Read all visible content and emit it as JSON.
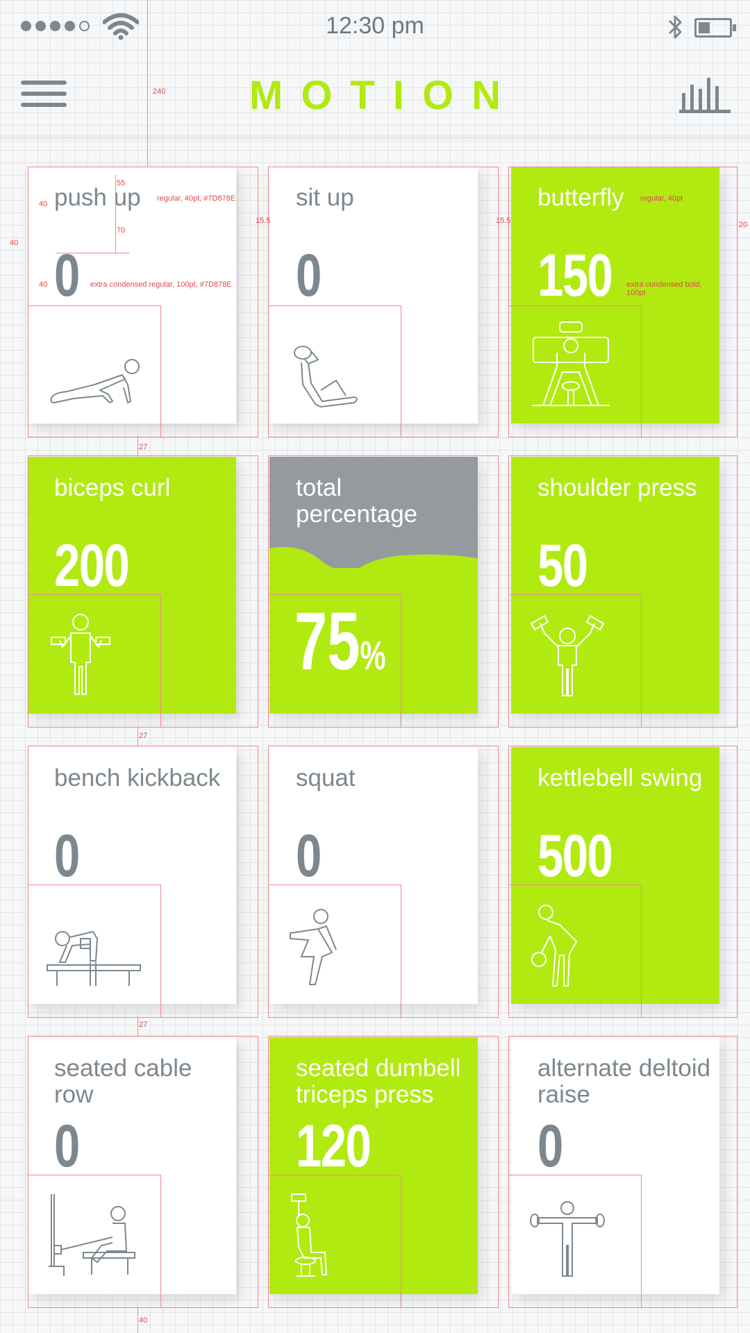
{
  "status_bar": {
    "time": "12:30 pm",
    "signal_dots": 5,
    "signal_filled": 4,
    "icons": [
      "wifi-icon",
      "bluetooth-icon",
      "battery-icon"
    ]
  },
  "header": {
    "title": "MOTION",
    "menu_icon": "hamburger-menu-icon",
    "stats_icon": "bar-chart-icon"
  },
  "colors": {
    "accent": "#B1EA10",
    "text": "#7D878E",
    "card": "#FFFFFF",
    "guide": "#F08A8A"
  },
  "exercises": [
    {
      "name": "push up",
      "value": "0",
      "style": "white",
      "icon": "push-up-figure"
    },
    {
      "name": "sit up",
      "value": "0",
      "style": "white",
      "icon": "sit-up-figure"
    },
    {
      "name": "butterfly",
      "value": "150",
      "style": "green",
      "icon": "butterfly-machine-figure"
    },
    {
      "name": "biceps curl",
      "value": "200",
      "style": "green",
      "icon": "biceps-curl-figure"
    },
    {
      "name": "total percentage",
      "value": "75",
      "unit": "%",
      "style": "percent",
      "icon": "wave"
    },
    {
      "name": "shoulder press",
      "value": "50",
      "style": "green",
      "icon": "shoulder-press-figure"
    },
    {
      "name": "bench kickback",
      "value": "0",
      "style": "white",
      "icon": "bench-kickback-figure"
    },
    {
      "name": "squat",
      "value": "0",
      "style": "white",
      "icon": "squat-figure"
    },
    {
      "name": "kettlebell swing",
      "value": "500",
      "style": "green",
      "icon": "kettlebell-swing-figure"
    },
    {
      "name": "seated cable row",
      "value": "0",
      "style": "white",
      "icon": "seated-cable-row-figure"
    },
    {
      "name": "seated dumbell triceps press",
      "value": "120",
      "style": "green",
      "icon": "triceps-press-figure"
    },
    {
      "name": "alternate deltoid raise",
      "value": "0",
      "style": "white",
      "icon": "deltoid-raise-figure"
    }
  ],
  "annotations": {
    "header_height": "240",
    "name_offset": "55",
    "name_gap": "70",
    "left_margin": "40",
    "value_margin": "40",
    "outer_margin": "40",
    "name_spec": "regular, 40pt, #7D878E",
    "value_spec": "extra condensed regular, 100pt, #7D878E",
    "green_name_spec": "regular, 40pt",
    "green_value_spec": "extra condensed bold, 100pt",
    "gutter_a": "15.5",
    "gutter_b": "15.5",
    "right_margin": "20",
    "row_gap_1": "27",
    "row_gap_2": "27",
    "row_gap_3": "27",
    "bottom_margin": "40"
  }
}
